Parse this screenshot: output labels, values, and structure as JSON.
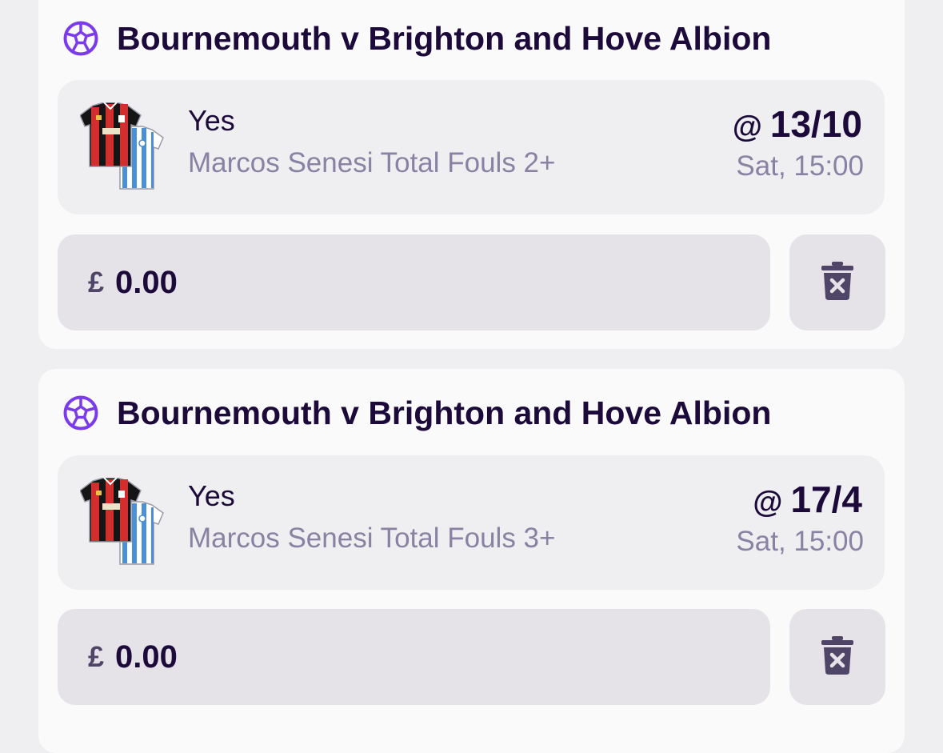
{
  "colors": {
    "accent": "#7c3aed",
    "text_primary": "#1c0b3a",
    "text_secondary": "#8a82a3",
    "card_bg": "#fafafa",
    "selection_bg": "#efeef0",
    "input_bg": "#e5e3e8"
  },
  "bets": [
    {
      "sport_icon": "football-icon",
      "event": "Bournemouth v Brighton and Hove Albion",
      "selection": "Yes",
      "market": "Marcos Senesi Total Fouls 2+",
      "odds_prefix": "@",
      "odds": "13/10",
      "kickoff": "Sat, 15:00",
      "currency": "£",
      "stake": "0.00",
      "delete_icon": "delete-icon"
    },
    {
      "sport_icon": "football-icon",
      "event": "Bournemouth v Brighton and Hove Albion",
      "selection": "Yes",
      "market": "Marcos Senesi Total Fouls 3+",
      "odds_prefix": "@",
      "odds": "17/4",
      "kickoff": "Sat, 15:00",
      "currency": "£",
      "stake": "0.00",
      "delete_icon": "delete-icon"
    }
  ]
}
